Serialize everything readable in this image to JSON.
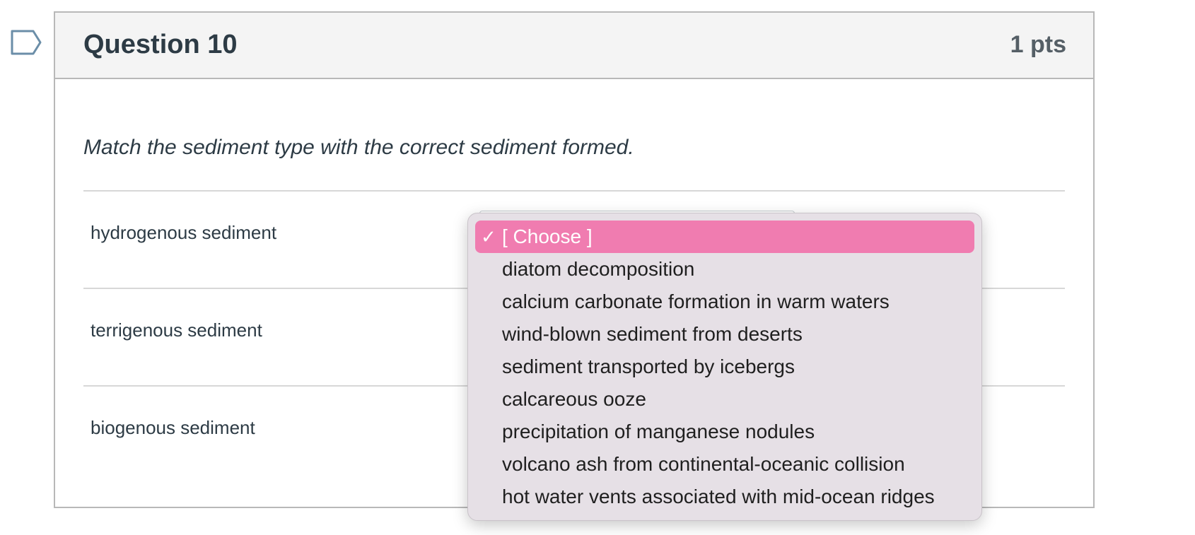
{
  "question": {
    "title": "Question 10",
    "points": "1 pts",
    "prompt": "Match the sediment type with the correct sediment formed."
  },
  "rows": [
    {
      "label": "hydrogenous sediment"
    },
    {
      "label": "terrigenous sediment"
    },
    {
      "label": "biogenous sediment"
    }
  ],
  "dropdown": {
    "selected_index": 0,
    "options": [
      "[ Choose ]",
      "diatom decomposition",
      "calcium carbonate formation in warm waters",
      "wind-blown sediment from deserts",
      "sediment transported by icebergs",
      "calcareous ooze",
      "precipitation of manganese nodules",
      "volcano ash from continental-oceanic collision",
      "hot water vents associated with mid-ocean ridges"
    ]
  },
  "colors": {
    "selected_highlight": "#f07cb0",
    "dropdown_bg": "#e6e0e6",
    "header_bg": "#f4f4f4",
    "text": "#2d3b45"
  },
  "icons": {
    "flag": "bookmark-flag-icon",
    "check": "checkmark-icon"
  }
}
